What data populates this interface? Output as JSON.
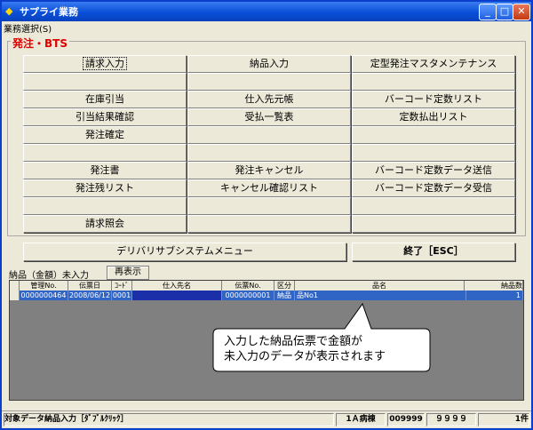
{
  "window": {
    "title": "サプライ業務"
  },
  "menu": {
    "item": "業務選択(S)"
  },
  "group": {
    "title": "発注・BTS"
  },
  "buttons": {
    "r1c1": "請求入力",
    "r1c2": "納品入力",
    "r1c3": "定型発注マスタメンテナンス",
    "r2c1": "",
    "r2c2": "",
    "r2c3": "",
    "r3c1": "在庫引当",
    "r3c2": "仕入先元帳",
    "r3c3": "バーコード定数リスト",
    "r4c1": "引当結果確認",
    "r4c2": "受払一覧表",
    "r4c3": "定数払出リスト",
    "r5c1": "発注確定",
    "r5c2": "",
    "r5c3": "",
    "r6c1": "",
    "r6c2": "",
    "r6c3": "",
    "r7c1": "発注書",
    "r7c2": "発注キャンセル",
    "r7c3": "バーコード定数データ送信",
    "r8c1": "発注残リスト",
    "r8c2": "キャンセル確認リスト",
    "r8c3": "バーコード定数データ受信",
    "r9c1": "",
    "r9c2": "",
    "r9c3": "",
    "r10c1": "請求照会",
    "r10c2": "",
    "r10c3": "",
    "delivery": "デリバリサブシステムメニュー",
    "exit": "終了［ESC］"
  },
  "list": {
    "label": "納品（金額）未入力",
    "refresh": "再表示",
    "headers": [
      "管理No.",
      "伝票日",
      "ｺｰﾄﾞ",
      "仕入先名",
      "伝票No.",
      "区分",
      "品名",
      "納品数"
    ],
    "row": [
      "0000000464",
      "2008/06/12",
      "0001",
      "",
      "0000000001",
      "納品",
      "品No1",
      "1"
    ]
  },
  "callout": {
    "line1": "入力した納品伝票で金額が",
    "line2": "未入力のデータが表示されます"
  },
  "status": {
    "hint": "対象データ納品入力［ﾀﾞﾌﾞﾙｸﾘｯｸ］",
    "ward": "1Ａ病棟",
    "code": "009999",
    "user": "９９９９",
    "count": "1件"
  }
}
